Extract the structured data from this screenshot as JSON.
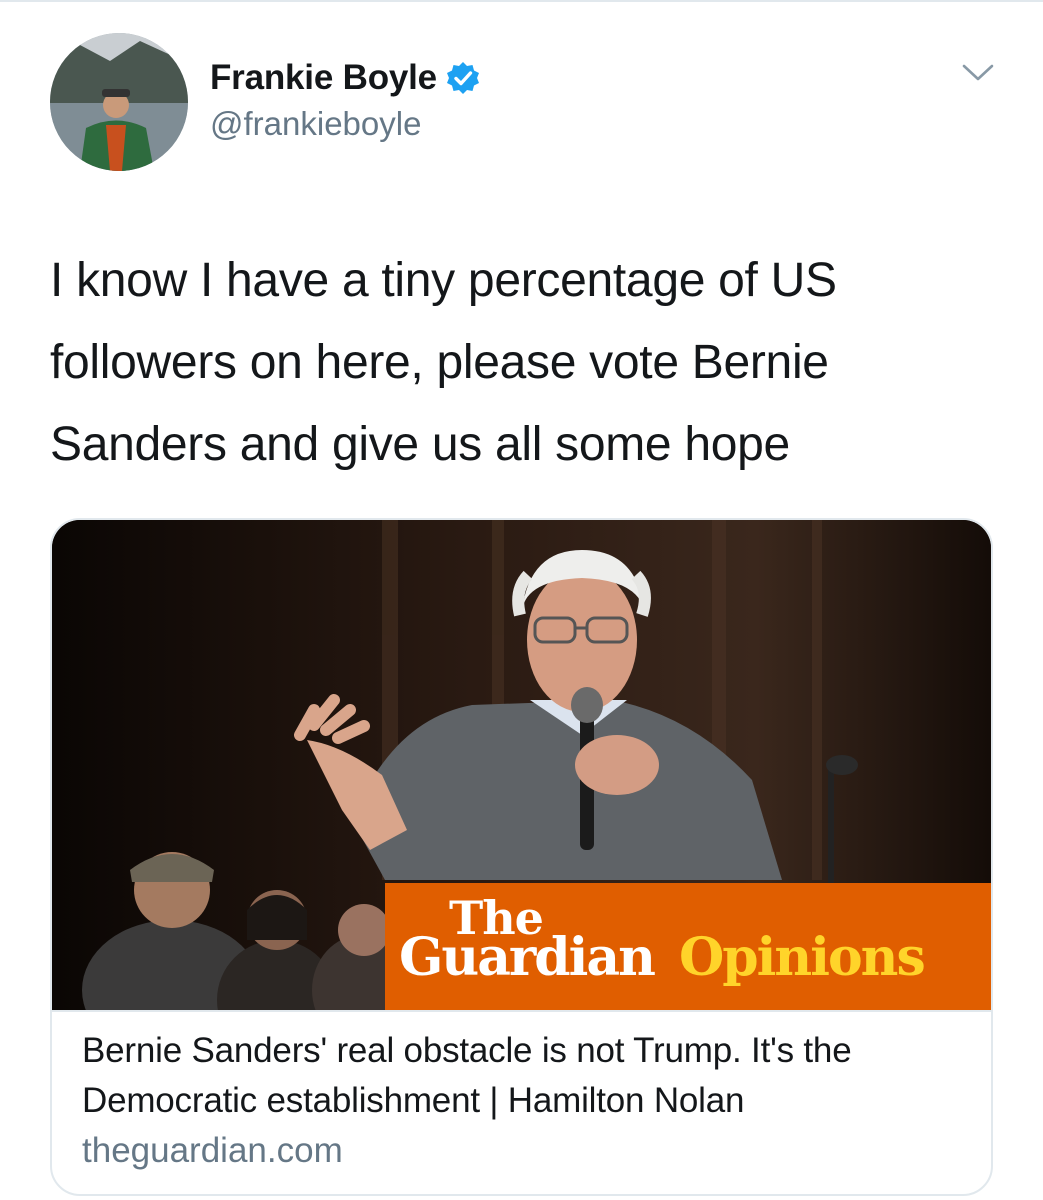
{
  "tweet": {
    "author": {
      "display_name": "Frankie Boyle",
      "handle": "@frankieboyle",
      "verified": true
    },
    "text": "I know I have a tiny percentage of US followers on here, please vote Bernie Sanders and give us all some hope"
  },
  "card": {
    "image_brand": {
      "the": "The",
      "guardian": "Guardian",
      "opinions": "Opinions"
    },
    "title": "Bernie Sanders' real obstacle is not Trump. It's the Democratic establishment | Hamilton Nolan",
    "domain": "theguardian.com"
  },
  "icons": {
    "verified": "verified-badge-icon",
    "menu": "chevron-down-icon"
  },
  "colors": {
    "text_primary": "#14171a",
    "text_secondary": "#657786",
    "verified_blue": "#1da1f2",
    "border": "#e1e8ed",
    "guardian_orange": "#e05e00",
    "guardian_yellow": "#ffd42a"
  }
}
